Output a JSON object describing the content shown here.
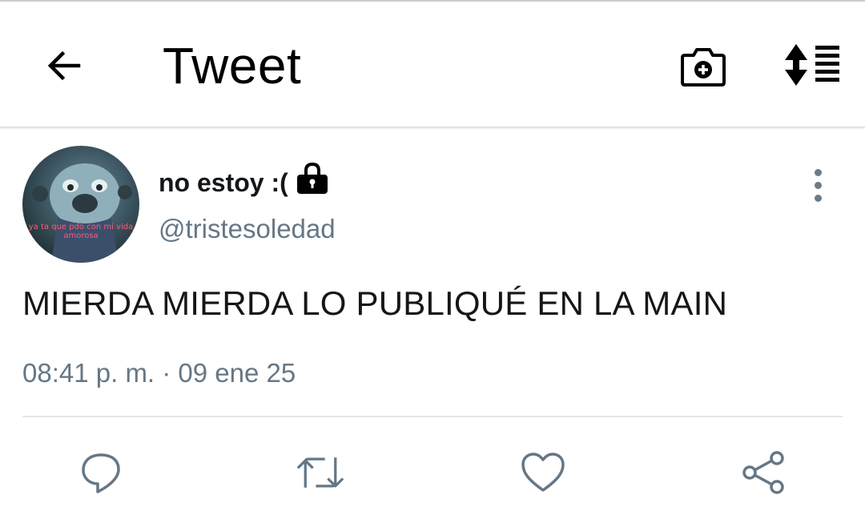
{
  "header": {
    "title": "Tweet",
    "back_icon": "arrow-left-icon",
    "camera_icon": "camera-plus-icon",
    "sort_icon": "sort-list-icon"
  },
  "tweet": {
    "display_name": "no estoy :(",
    "protected_icon": "lock-icon",
    "handle": "@tristesoledad",
    "avatar_caption": "ya ta que pdo con mi vida amorosa",
    "text": "MIERDA MIERDA LO PUBLIQUÉ EN LA MAIN",
    "timestamp": "08:41 p. m. · 09 ene 25",
    "more_icon": "more-vertical-icon"
  },
  "actions": [
    {
      "name": "reply",
      "icon": "reply-icon"
    },
    {
      "name": "retweet",
      "icon": "retweet-icon"
    },
    {
      "name": "like",
      "icon": "heart-icon"
    },
    {
      "name": "share",
      "icon": "share-icon"
    }
  ],
  "colors": {
    "text_primary": "#14171a",
    "text_secondary": "#657786",
    "divider": "#e1e8ed",
    "icon_gray": "#657786"
  }
}
